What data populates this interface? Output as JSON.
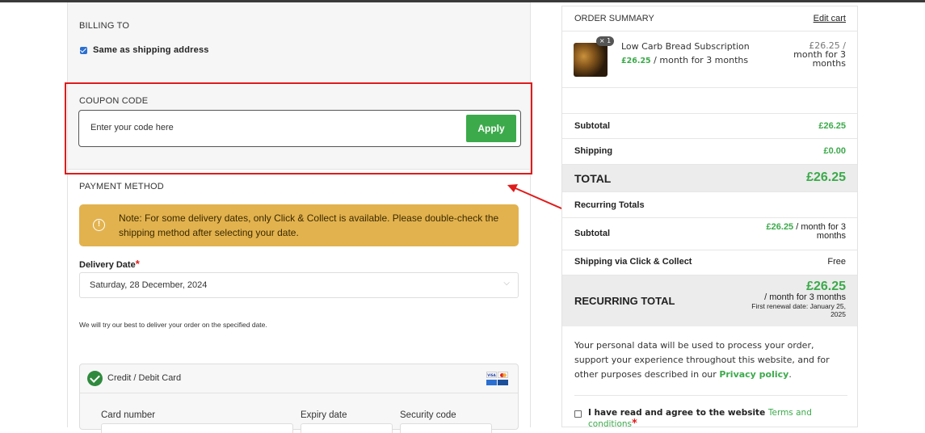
{
  "billing": {
    "heading": "BILLING TO",
    "same_label": "Same as shipping address"
  },
  "coupon": {
    "heading": "COUPON CODE",
    "placeholder": "Enter your code here",
    "apply_label": "Apply"
  },
  "payment": {
    "heading": "PAYMENT METHOD",
    "notice": "Note: For some delivery dates, only Click & Collect is available. Please double-check the shipping method after selecting your date.",
    "delivery_label": "Delivery Date",
    "required_star": "*",
    "delivery_value": "Saturday, 28 December, 2024",
    "delivery_note": "We will try our best to deliver your order on the specified date.",
    "card_option": "Credit / Debit Card",
    "card_number_label": "Card number",
    "expiry_label": "Expiry date",
    "security_label": "Security code"
  },
  "summary": {
    "heading": "ORDER SUMMARY",
    "edit_cart": "Edit cart",
    "item": {
      "qty_badge": "× 1",
      "name": "Low Carb Bread Subscription",
      "price_green": "£26.25",
      "price_suffix": " / month for 3 months",
      "right_price": "£26.25 /",
      "right_price2": "month for 3",
      "right_price3": "months"
    },
    "subtotal_label": "Subtotal",
    "subtotal_value": "£26.25",
    "shipping_label": "Shipping",
    "shipping_value": "£0.00",
    "total_label": "TOTAL",
    "total_value": "£26.25",
    "recurring_heading": "Recurring Totals",
    "rec_subtotal_label": "Subtotal",
    "rec_subtotal_green": "£26.25",
    "rec_subtotal_suffix": " / month for 3",
    "rec_subtotal_suffix2": "months",
    "rec_shipping_label": "Shipping via Click & Collect",
    "rec_shipping_value": "Free",
    "rec_total_label": "RECURRING TOTAL",
    "rec_total_value": "£26.25",
    "rec_total_period": "/ month for 3 months",
    "renewal_line1": "First renewal date: January 25,",
    "renewal_line2": "2025",
    "privacy_text": "Your personal data will be used to process your order, support your experience throughout this website, and for other purposes described in our ",
    "privacy_link": "Privacy policy",
    "privacy_end": ".",
    "terms_text": "I have read and agree to the website ",
    "terms_link": "Terms and conditions",
    "terms_star": "*"
  },
  "colors": {
    "accent_green": "#3caa4b",
    "notice_yellow": "#e2b24e",
    "annotation_red": "#e01b1b"
  },
  "icons": [
    "checkbox-icon",
    "info-icon",
    "chevron-down-icon",
    "check-circle-icon",
    "visa-icon",
    "mastercard-icon"
  ]
}
